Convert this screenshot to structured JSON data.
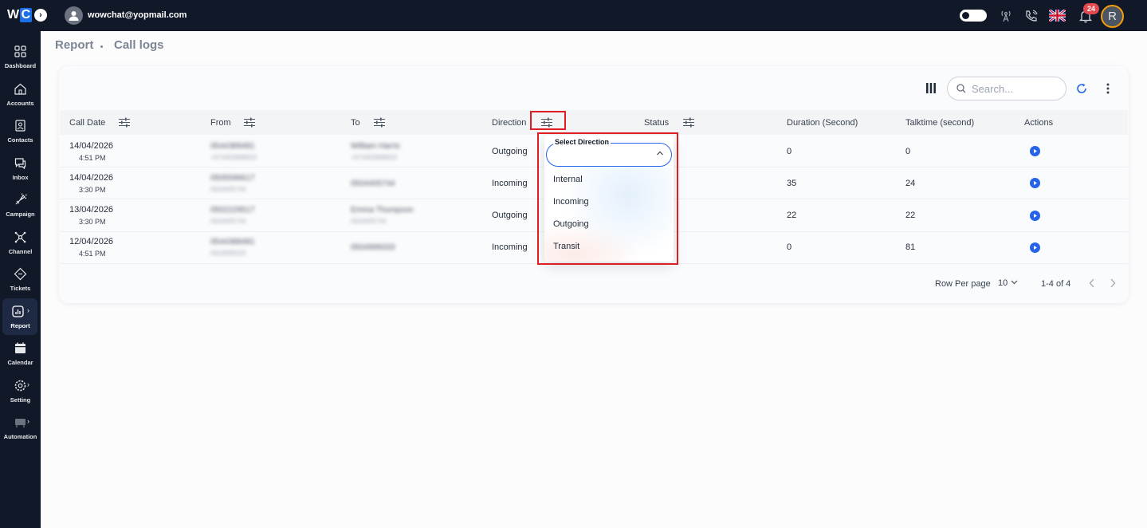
{
  "topbar": {
    "logo_text": "W",
    "logo_accent": "C",
    "user_email": "wowchat@yopmail.com",
    "notification_count": "24",
    "avatar_initial": "R"
  },
  "sidebar": {
    "items": [
      {
        "label": "Dashboard"
      },
      {
        "label": "Accounts"
      },
      {
        "label": "Contacts"
      },
      {
        "label": "Inbox"
      },
      {
        "label": "Campaign"
      },
      {
        "label": "Channel"
      },
      {
        "label": "Tickets"
      },
      {
        "label": "Report"
      },
      {
        "label": "Calendar"
      },
      {
        "label": "Setting"
      },
      {
        "label": "Automation"
      }
    ],
    "active": "Report"
  },
  "breadcrumb": [
    "Report",
    "Call logs"
  ],
  "toolbar": {
    "search_placeholder": "Search..."
  },
  "table": {
    "columns": [
      "Call Date",
      "From",
      "To",
      "Direction",
      "Status",
      "Duration (Second)",
      "Talktime (second)",
      "Actions"
    ],
    "rows": [
      {
        "date": "14/04/2026",
        "time": "4:51 PM",
        "from": "0544389481",
        "from_sub": "+974459888833",
        "to": "William Harris",
        "to_sub": "+974459888833",
        "direction": "Outgoing",
        "duration": "0",
        "talktime": "0"
      },
      {
        "date": "14/04/2026",
        "time": "3:30 PM",
        "from": "0505596617",
        "from_sub": "0504405744",
        "to": "0504405744",
        "to_sub": "",
        "direction": "Incoming",
        "duration": "35",
        "talktime": "24"
      },
      {
        "date": "13/04/2026",
        "time": "3:30 PM",
        "from": "0502229517",
        "from_sub": "0504405744",
        "to": "Emma Thompson",
        "to_sub": "0504405744",
        "direction": "Outgoing",
        "duration": "22",
        "talktime": "22"
      },
      {
        "date": "12/04/2026",
        "time": "4:51 PM",
        "from": "0544388481",
        "from_sub": "0504999333",
        "to": "0504999333",
        "to_sub": "",
        "direction": "Incoming",
        "duration": "0",
        "talktime": "81"
      }
    ]
  },
  "pagination": {
    "rows_label": "Row Per page",
    "rows_value": "10",
    "range": "1-4 of 4"
  },
  "direction_filter": {
    "legend": "Select Direction",
    "options": [
      "Internal",
      "Incoming",
      "Outgoing",
      "Transit"
    ]
  },
  "colors": {
    "accent": "#2563eb",
    "highlight": "#e11d24",
    "sidebar_bg": "#111827"
  }
}
